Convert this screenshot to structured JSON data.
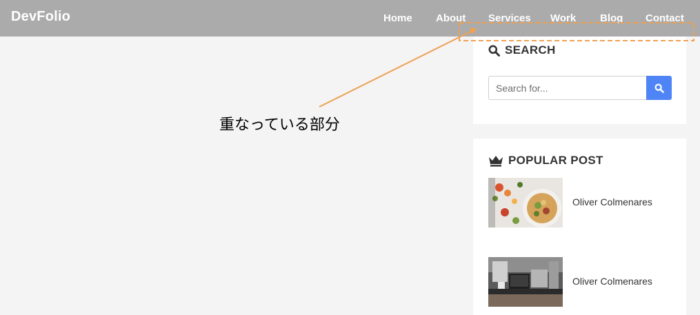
{
  "brand": "DevFolio",
  "nav": {
    "items": [
      {
        "label": "Home"
      },
      {
        "label": "About"
      },
      {
        "label": "Services"
      },
      {
        "label": "Work"
      },
      {
        "label": "Blog"
      },
      {
        "label": "Contact"
      }
    ]
  },
  "search_widget": {
    "title": "SEARCH",
    "placeholder": "Search for...",
    "icon": "search-icon"
  },
  "popular_widget": {
    "title": "POPULAR POST",
    "icon": "crown-icon",
    "posts": [
      {
        "title": "Oliver Colmenares"
      },
      {
        "title": "Oliver Colmenares"
      }
    ]
  },
  "annotation": {
    "text": "重なっている部分"
  },
  "colors": {
    "navbar": "#ababab",
    "page_background": "#f4f4f4",
    "accent": "#4e84f5",
    "annotation": "#f0a050"
  }
}
